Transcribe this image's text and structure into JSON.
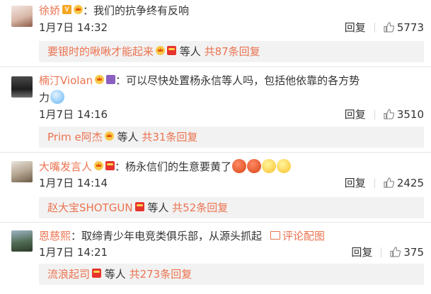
{
  "comments": [
    {
      "username": "徐娇",
      "separator": "：",
      "text": "我们的抗争终有反响",
      "time": "1月7日 14:32",
      "reply_label": "回复",
      "likes": "5773",
      "sub": {
        "name": "要银时的啾啾才能起来",
        "mid": "等人",
        "count": "共87条回复"
      }
    },
    {
      "username": "楠汀Violan",
      "separator": "：",
      "text": "可以尽快处置杨永信等人吗，包括他依靠的各方势",
      "text2": "力",
      "time": "1月7日 14:16",
      "reply_label": "回复",
      "likes": "3510",
      "sub": {
        "name": "Prim e阿杰",
        "mid": "等人",
        "count": "共31条回复"
      }
    },
    {
      "username": "大嘴发言人",
      "separator": "：",
      "text": "杨永信们的生意要黄了",
      "time": "1月7日 14:14",
      "reply_label": "回复",
      "likes": "2425",
      "sub": {
        "name": "赵大宝SHOTGUN",
        "mid": "等人",
        "count": "共52条回复"
      }
    },
    {
      "username": "恩慈熙",
      "separator": "：",
      "text": "取缔青少年电竞类俱乐部，从源头抓起",
      "pic_label": "评论配图",
      "time": "1月7日 14:21",
      "reply_label": "回复",
      "likes": "375",
      "sub": {
        "name": "流浪起司",
        "mid": "等人",
        "count": "共273条回复"
      }
    }
  ]
}
